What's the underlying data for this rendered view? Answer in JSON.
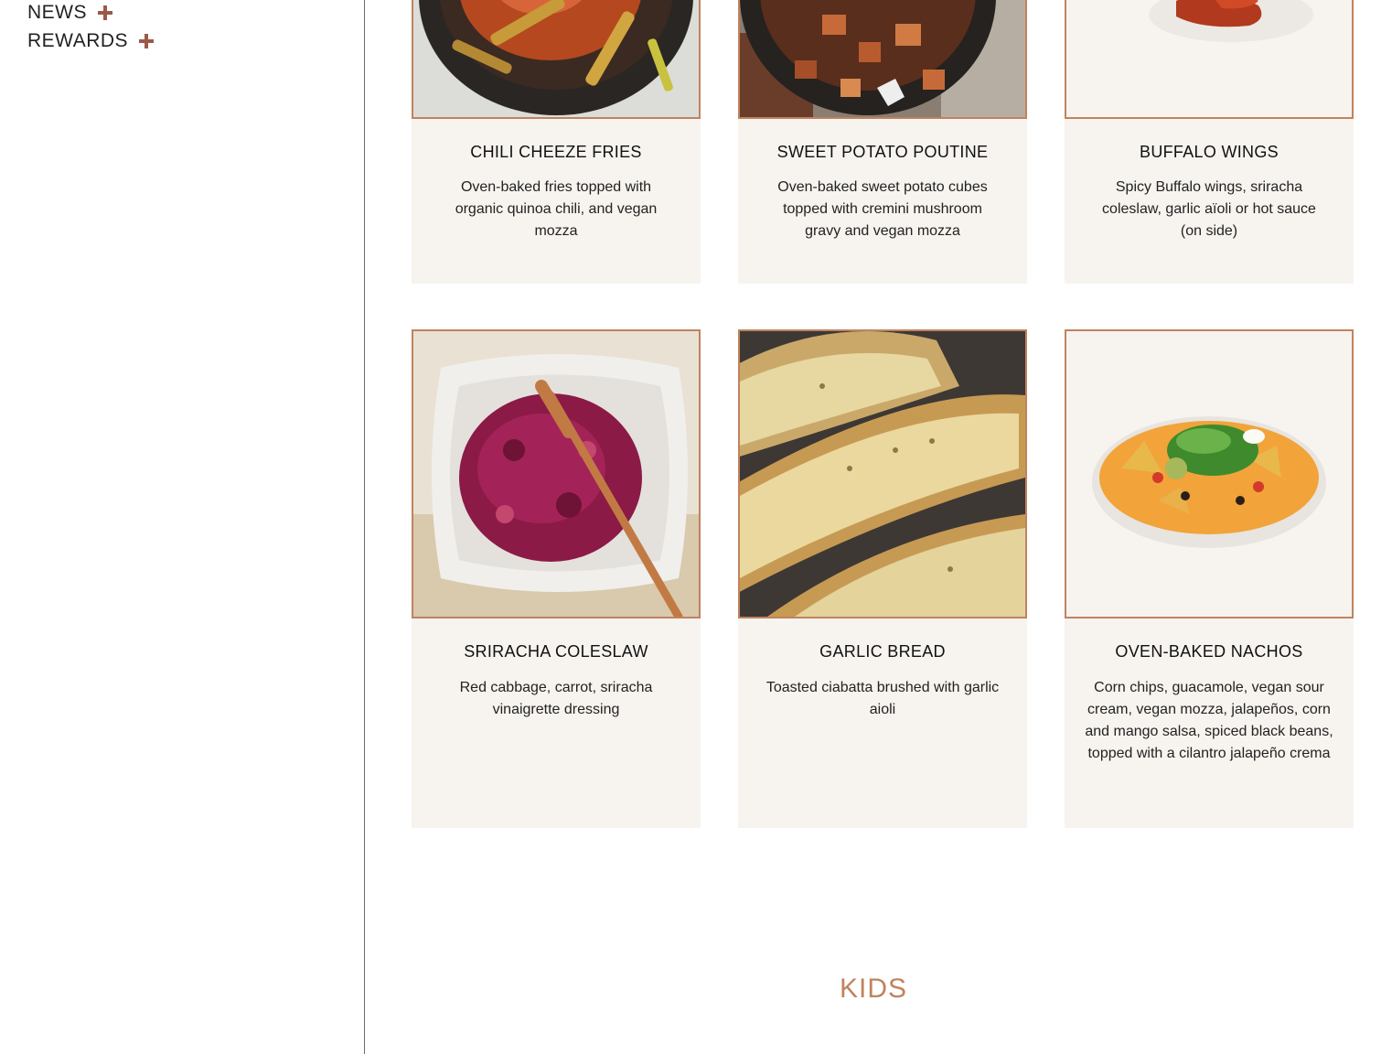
{
  "sidebar": {
    "items": [
      {
        "label": "NEWS"
      },
      {
        "label": "REWARDS"
      }
    ]
  },
  "menu": {
    "row1": [
      {
        "title": "CHILI CHEEZE FRIES",
        "description": "Oven-baked fries topped with organic quinoa chili, and vegan mozza"
      },
      {
        "title": "SWEET POTATO POUTINE",
        "description": "Oven-baked sweet potato cubes topped with cremini mushroom gravy and vegan mozza"
      },
      {
        "title": "BUFFALO WINGS",
        "description": "Spicy Buffalo wings, sriracha coleslaw, garlic aïoli or hot sauce (on side)"
      }
    ],
    "row2": [
      {
        "title": "SRIRACHA COLESLAW",
        "description": "Red cabbage, carrot, sriracha vinaigrette dressing"
      },
      {
        "title": "GARLIC BREAD",
        "description": "Toasted ciabatta brushed with garlic aioli"
      },
      {
        "title": "OVEN-BAKED NACHOS",
        "description": "Corn chips, guacamole, vegan sour cream, vegan mozza, jalapeños, corn and mango salsa, spiced black beans, topped with a cilantro jalapeño crema"
      }
    ]
  },
  "section": {
    "kids_title": "KIDS"
  },
  "colors": {
    "accent": "#c0835e",
    "plus": "#9a5a47",
    "card_bg": "#f7f4ef"
  }
}
